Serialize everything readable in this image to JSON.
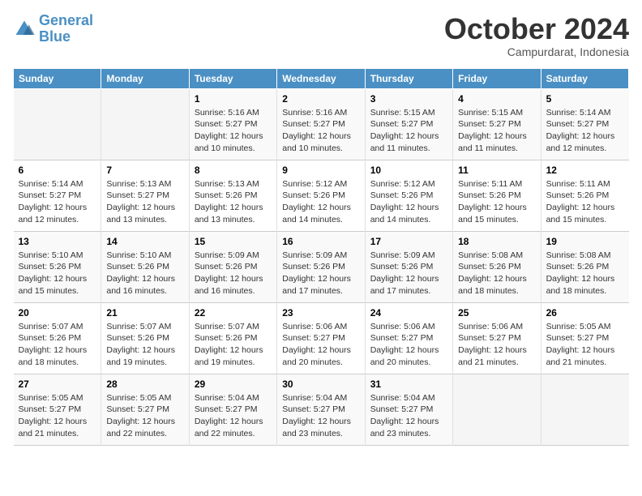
{
  "logo": {
    "general": "General",
    "blue": "Blue"
  },
  "header": {
    "month": "October 2024",
    "location": "Campurdarat, Indonesia"
  },
  "days_of_week": [
    "Sunday",
    "Monday",
    "Tuesday",
    "Wednesday",
    "Thursday",
    "Friday",
    "Saturday"
  ],
  "weeks": [
    [
      {
        "day": "",
        "sunrise": "",
        "sunset": "",
        "daylight": "",
        "empty": true
      },
      {
        "day": "",
        "sunrise": "",
        "sunset": "",
        "daylight": "",
        "empty": true
      },
      {
        "day": "1",
        "sunrise": "Sunrise: 5:16 AM",
        "sunset": "Sunset: 5:27 PM",
        "daylight": "Daylight: 12 hours and 10 minutes."
      },
      {
        "day": "2",
        "sunrise": "Sunrise: 5:16 AM",
        "sunset": "Sunset: 5:27 PM",
        "daylight": "Daylight: 12 hours and 10 minutes."
      },
      {
        "day": "3",
        "sunrise": "Sunrise: 5:15 AM",
        "sunset": "Sunset: 5:27 PM",
        "daylight": "Daylight: 12 hours and 11 minutes."
      },
      {
        "day": "4",
        "sunrise": "Sunrise: 5:15 AM",
        "sunset": "Sunset: 5:27 PM",
        "daylight": "Daylight: 12 hours and 11 minutes."
      },
      {
        "day": "5",
        "sunrise": "Sunrise: 5:14 AM",
        "sunset": "Sunset: 5:27 PM",
        "daylight": "Daylight: 12 hours and 12 minutes."
      }
    ],
    [
      {
        "day": "6",
        "sunrise": "Sunrise: 5:14 AM",
        "sunset": "Sunset: 5:27 PM",
        "daylight": "Daylight: 12 hours and 12 minutes."
      },
      {
        "day": "7",
        "sunrise": "Sunrise: 5:13 AM",
        "sunset": "Sunset: 5:27 PM",
        "daylight": "Daylight: 12 hours and 13 minutes."
      },
      {
        "day": "8",
        "sunrise": "Sunrise: 5:13 AM",
        "sunset": "Sunset: 5:26 PM",
        "daylight": "Daylight: 12 hours and 13 minutes."
      },
      {
        "day": "9",
        "sunrise": "Sunrise: 5:12 AM",
        "sunset": "Sunset: 5:26 PM",
        "daylight": "Daylight: 12 hours and 14 minutes."
      },
      {
        "day": "10",
        "sunrise": "Sunrise: 5:12 AM",
        "sunset": "Sunset: 5:26 PM",
        "daylight": "Daylight: 12 hours and 14 minutes."
      },
      {
        "day": "11",
        "sunrise": "Sunrise: 5:11 AM",
        "sunset": "Sunset: 5:26 PM",
        "daylight": "Daylight: 12 hours and 15 minutes."
      },
      {
        "day": "12",
        "sunrise": "Sunrise: 5:11 AM",
        "sunset": "Sunset: 5:26 PM",
        "daylight": "Daylight: 12 hours and 15 minutes."
      }
    ],
    [
      {
        "day": "13",
        "sunrise": "Sunrise: 5:10 AM",
        "sunset": "Sunset: 5:26 PM",
        "daylight": "Daylight: 12 hours and 15 minutes."
      },
      {
        "day": "14",
        "sunrise": "Sunrise: 5:10 AM",
        "sunset": "Sunset: 5:26 PM",
        "daylight": "Daylight: 12 hours and 16 minutes."
      },
      {
        "day": "15",
        "sunrise": "Sunrise: 5:09 AM",
        "sunset": "Sunset: 5:26 PM",
        "daylight": "Daylight: 12 hours and 16 minutes."
      },
      {
        "day": "16",
        "sunrise": "Sunrise: 5:09 AM",
        "sunset": "Sunset: 5:26 PM",
        "daylight": "Daylight: 12 hours and 17 minutes."
      },
      {
        "day": "17",
        "sunrise": "Sunrise: 5:09 AM",
        "sunset": "Sunset: 5:26 PM",
        "daylight": "Daylight: 12 hours and 17 minutes."
      },
      {
        "day": "18",
        "sunrise": "Sunrise: 5:08 AM",
        "sunset": "Sunset: 5:26 PM",
        "daylight": "Daylight: 12 hours and 18 minutes."
      },
      {
        "day": "19",
        "sunrise": "Sunrise: 5:08 AM",
        "sunset": "Sunset: 5:26 PM",
        "daylight": "Daylight: 12 hours and 18 minutes."
      }
    ],
    [
      {
        "day": "20",
        "sunrise": "Sunrise: 5:07 AM",
        "sunset": "Sunset: 5:26 PM",
        "daylight": "Daylight: 12 hours and 18 minutes."
      },
      {
        "day": "21",
        "sunrise": "Sunrise: 5:07 AM",
        "sunset": "Sunset: 5:26 PM",
        "daylight": "Daylight: 12 hours and 19 minutes."
      },
      {
        "day": "22",
        "sunrise": "Sunrise: 5:07 AM",
        "sunset": "Sunset: 5:26 PM",
        "daylight": "Daylight: 12 hours and 19 minutes."
      },
      {
        "day": "23",
        "sunrise": "Sunrise: 5:06 AM",
        "sunset": "Sunset: 5:27 PM",
        "daylight": "Daylight: 12 hours and 20 minutes."
      },
      {
        "day": "24",
        "sunrise": "Sunrise: 5:06 AM",
        "sunset": "Sunset: 5:27 PM",
        "daylight": "Daylight: 12 hours and 20 minutes."
      },
      {
        "day": "25",
        "sunrise": "Sunrise: 5:06 AM",
        "sunset": "Sunset: 5:27 PM",
        "daylight": "Daylight: 12 hours and 21 minutes."
      },
      {
        "day": "26",
        "sunrise": "Sunrise: 5:05 AM",
        "sunset": "Sunset: 5:27 PM",
        "daylight": "Daylight: 12 hours and 21 minutes."
      }
    ],
    [
      {
        "day": "27",
        "sunrise": "Sunrise: 5:05 AM",
        "sunset": "Sunset: 5:27 PM",
        "daylight": "Daylight: 12 hours and 21 minutes."
      },
      {
        "day": "28",
        "sunrise": "Sunrise: 5:05 AM",
        "sunset": "Sunset: 5:27 PM",
        "daylight": "Daylight: 12 hours and 22 minutes."
      },
      {
        "day": "29",
        "sunrise": "Sunrise: 5:04 AM",
        "sunset": "Sunset: 5:27 PM",
        "daylight": "Daylight: 12 hours and 22 minutes."
      },
      {
        "day": "30",
        "sunrise": "Sunrise: 5:04 AM",
        "sunset": "Sunset: 5:27 PM",
        "daylight": "Daylight: 12 hours and 23 minutes."
      },
      {
        "day": "31",
        "sunrise": "Sunrise: 5:04 AM",
        "sunset": "Sunset: 5:27 PM",
        "daylight": "Daylight: 12 hours and 23 minutes."
      },
      {
        "day": "",
        "sunrise": "",
        "sunset": "",
        "daylight": "",
        "empty": true
      },
      {
        "day": "",
        "sunrise": "",
        "sunset": "",
        "daylight": "",
        "empty": true
      }
    ]
  ]
}
